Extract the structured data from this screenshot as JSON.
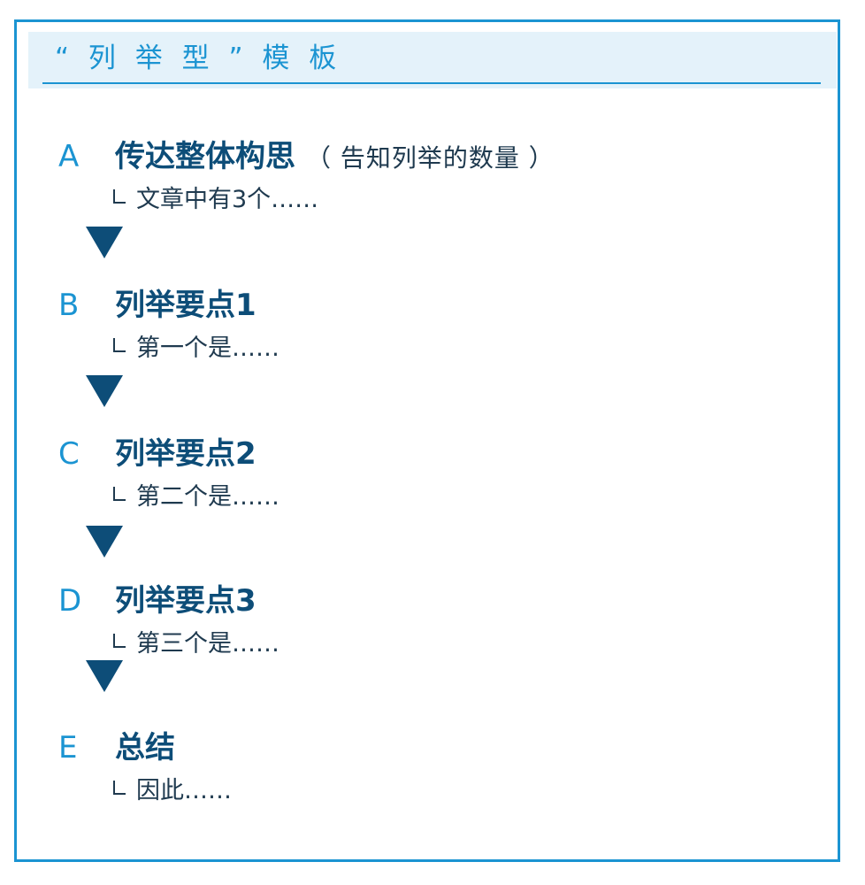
{
  "title": "“ 列 举 型 ” 模 板",
  "steps": [
    {
      "letter": "A",
      "heading": "传达整体构思",
      "aside": "（ 告知列举的数量 ）",
      "detail": "文章中有3个……"
    },
    {
      "letter": "B",
      "heading": "列举要点1",
      "aside": "",
      "detail": "第一个是……"
    },
    {
      "letter": "C",
      "heading": "列举要点2",
      "aside": "",
      "detail": "第二个是……"
    },
    {
      "letter": "D",
      "heading": "列举要点3",
      "aside": "",
      "detail": "第三个是……"
    },
    {
      "letter": "E",
      "heading": "总结",
      "aside": "",
      "detail": "因此……"
    }
  ],
  "colors": {
    "accent": "#1b94d2",
    "heading": "#0d4d78",
    "highlight": "#cfe8f5",
    "header_band": "#e4f2fa",
    "text": "#1f3a4f"
  },
  "icons": {
    "connector": "down-triangle-icon",
    "sub_item": "corner-bracket-icon"
  }
}
